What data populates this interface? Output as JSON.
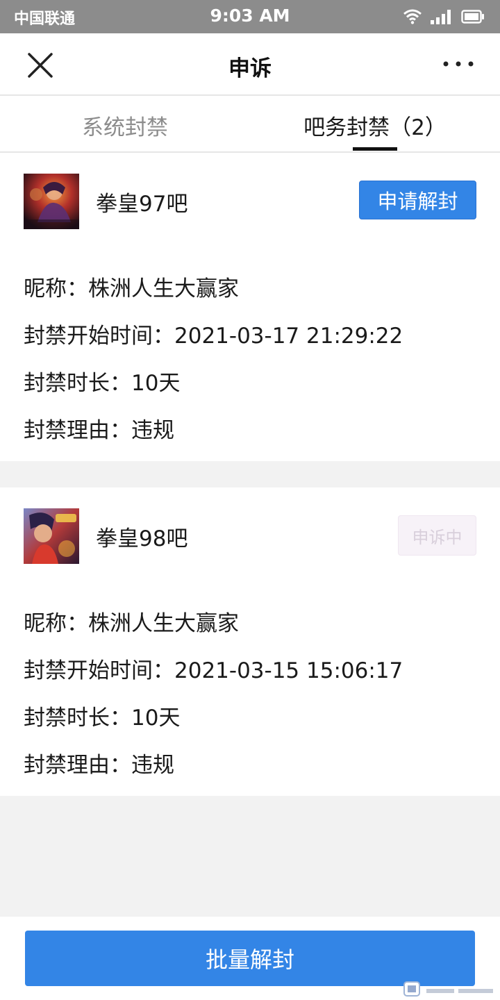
{
  "status_bar": {
    "carrier": "中国联通",
    "time": "9:03 AM"
  },
  "nav": {
    "title": "申诉"
  },
  "tabs": [
    {
      "label": "系统封禁",
      "active": false
    },
    {
      "label": "吧务封禁（2）",
      "active": true
    }
  ],
  "cards": [
    {
      "forum_name": "拳皇97吧",
      "action_label": "申请解封",
      "rows": [
        "昵称：株洲人生大赢家",
        "封禁开始时间：2021-03-17 21:29:22",
        "封禁时长：10天",
        "封禁理由：违规"
      ]
    },
    {
      "forum_name": "拳皇98吧",
      "action_label": "申诉中",
      "rows": [
        "昵称：株洲人生大赢家",
        "封禁开始时间：2021-03-15 15:06:17",
        "封禁时长：10天",
        "封禁理由：违规"
      ]
    }
  ],
  "bottom": {
    "batch_label": "批量解封"
  },
  "colors": {
    "accent": "#3385e6",
    "status_bar": "#8c8c8c",
    "background": "#f2f2f2"
  },
  "icons": [
    "close-icon",
    "more-icon",
    "wifi-icon",
    "signal-icon",
    "battery-icon"
  ]
}
